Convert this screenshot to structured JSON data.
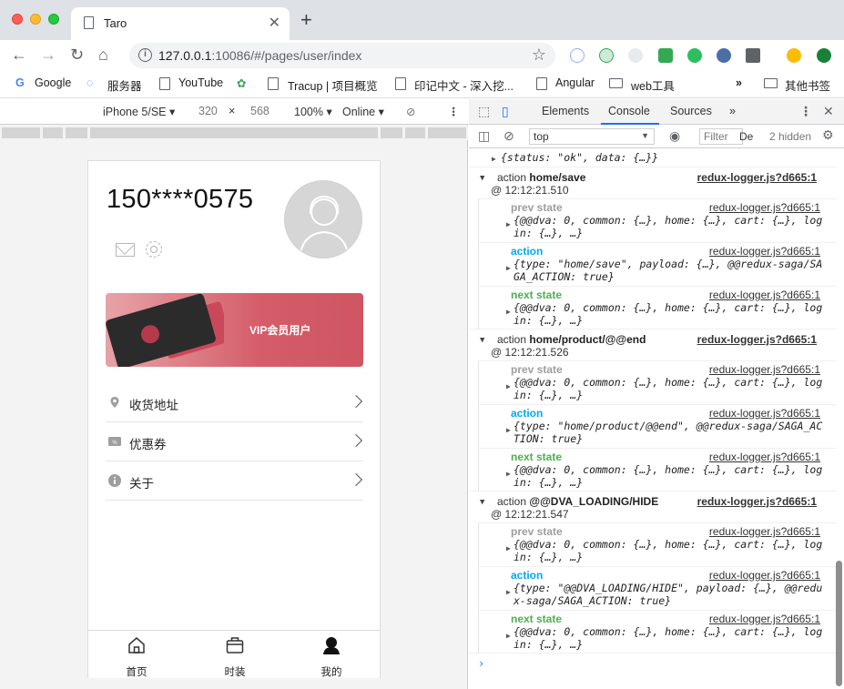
{
  "browser": {
    "tab_title": "Taro",
    "url_host": "127.0.0.1",
    "url_rest": ":10086/#/pages/user/index",
    "bookmarks": [
      "Google",
      "服务器",
      "YouTube",
      "Tracup | 项目概览",
      "印记中文 - 深入挖...",
      "Angular",
      "web工具"
    ],
    "bookmarks_overflow": "»",
    "other_bookmarks": "其他书签"
  },
  "device_toolbar": {
    "device": "iPhone 5/SE ▾",
    "width": "320",
    "times": "×",
    "height": "568",
    "zoom": "100% ▾",
    "network": "Online ▾"
  },
  "app": {
    "phone_number": "150****0575",
    "vip_label": "VIP会员用户",
    "menu": [
      {
        "label": "收货地址"
      },
      {
        "label": "优惠券"
      },
      {
        "label": "关于"
      }
    ],
    "tabbar": [
      {
        "label": "首页"
      },
      {
        "label": "时装"
      },
      {
        "label": "我的"
      }
    ]
  },
  "devtools": {
    "tabs": [
      "Elements",
      "Console",
      "Sources",
      "»"
    ],
    "active_tab": "Console",
    "context": "top",
    "filter_placeholder": "Filter",
    "levels": "De",
    "hidden": "2 hidden",
    "partial_first_line": "{status: \"ok\", data: {…}}",
    "groups": [
      {
        "action_word": "action",
        "action_name": "home/save",
        "link": "redux-logger.js?d665:1",
        "time": "@ 12:12:21.510",
        "lines": [
          {
            "kind": "prev state",
            "link": "redux-logger.js?d665:1",
            "body": "{@@dva: 0, common: {…}, home: {…}, cart: {…}, login: {…}, …}"
          },
          {
            "kind": "action",
            "link": "redux-logger.js?d665:1",
            "body": "{type: \"home/save\", payload: {…}, @@redux-saga/SAGA_ACTION: true}"
          },
          {
            "kind": "next state",
            "link": "redux-logger.js?d665:1",
            "body": "{@@dva: 0, common: {…}, home: {…}, cart: {…}, login: {…}, …}"
          }
        ]
      },
      {
        "action_word": "action",
        "action_name": "home/product/@@end",
        "link": "redux-logger.js?d665:1",
        "time": "@ 12:12:21.526",
        "lines": [
          {
            "kind": "prev state",
            "link": "redux-logger.js?d665:1",
            "body": "{@@dva: 0, common: {…}, home: {…}, cart: {…}, login: {…}, …}"
          },
          {
            "kind": "action",
            "link": "redux-logger.js?d665:1",
            "body": "{type: \"home/product/@@end\", @@redux-saga/SAGA_ACTION: true}"
          },
          {
            "kind": "next state",
            "link": "redux-logger.js?d665:1",
            "body": "{@@dva: 0, common: {…}, home: {…}, cart: {…}, login: {…}, …}"
          }
        ]
      },
      {
        "action_word": "action",
        "action_name": "@@DVA_LOADING/HIDE",
        "link": "redux-logger.js?d665:1",
        "time": "@ 12:12:21.547",
        "lines": [
          {
            "kind": "prev state",
            "link": "redux-logger.js?d665:1",
            "body": "{@@dva: 0, common: {…}, home: {…}, cart: {…}, login: {…}, …}"
          },
          {
            "kind": "action",
            "link": "redux-logger.js?d665:1",
            "body": "{type: \"@@DVA_LOADING/HIDE\", payload: {…}, @@redux-saga/SAGA_ACTION: true}"
          },
          {
            "kind": "next state",
            "link": "redux-logger.js?d665:1",
            "body": "{@@dva: 0, common: {…}, home: {…}, cart: {…}, login: {…}, …}"
          }
        ]
      }
    ],
    "prompt": "›"
  }
}
